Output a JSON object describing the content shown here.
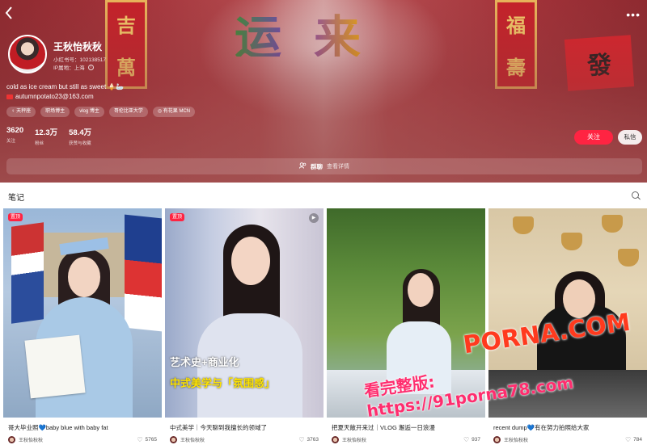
{
  "header": {
    "back_icon": "chevron-left-icon",
    "more_icon": "more-dots-icon",
    "banner_text": "运来",
    "banner_scroll_left": [
      "吉",
      "萬"
    ],
    "banner_scroll_right": [
      "福",
      "壽"
    ],
    "banner_card": "發"
  },
  "profile": {
    "name": "王秋怡秋秋",
    "xhs_id": "小红书号：102138517",
    "ip_location": "IP属地：上海",
    "bio": "cold as ice cream but still as sweet 🍦🦢",
    "email": "autumnpotato23@163.com",
    "tags": [
      "♀ 天秤座",
      "职场博主",
      "vlog 博主",
      "哥伦比亚大学",
      "◎ 有花果 MCN"
    ],
    "stats": [
      {
        "value": "3620",
        "label": "关注"
      },
      {
        "value": "12.3万",
        "label": "粉丝"
      },
      {
        "value": "58.4万",
        "label": "获赞与收藏"
      }
    ],
    "follow_label": "关注",
    "message_label": "私信",
    "group_chat_label": "群聊",
    "group_chat_detail": "查看详情"
  },
  "notes": {
    "section_title": "笔记",
    "cards": [
      {
        "title": "哥大毕业照💙baby blue with baby fat",
        "author": "王秋怡秋秋",
        "likes": "5765",
        "badge": "置顶",
        "video": false
      },
      {
        "title": "中式美学｜今天聊到我擅长的领域了",
        "author": "王秋怡秋秋",
        "likes": "3763",
        "badge": "置顶",
        "video": true,
        "overlay_line1": "艺术史+商业化",
        "overlay_line2": "中式美学与「氛围感」"
      },
      {
        "title": "把夏天敞开来过｜VLOG 邂逅一日浪漫",
        "author": "王秋怡秋秋",
        "likes": "937",
        "badge": "",
        "video": false
      },
      {
        "title": "recent dump💙有在努力拍照给大家",
        "author": "王秋怡秋秋",
        "likes": "784",
        "badge": "",
        "video": false
      }
    ]
  },
  "watermark": {
    "line1": "PORNA.COM",
    "line2": "看完整版: https://91porna78.com"
  },
  "colors": {
    "accent": "#ff2442",
    "banner": "#a3333a"
  }
}
